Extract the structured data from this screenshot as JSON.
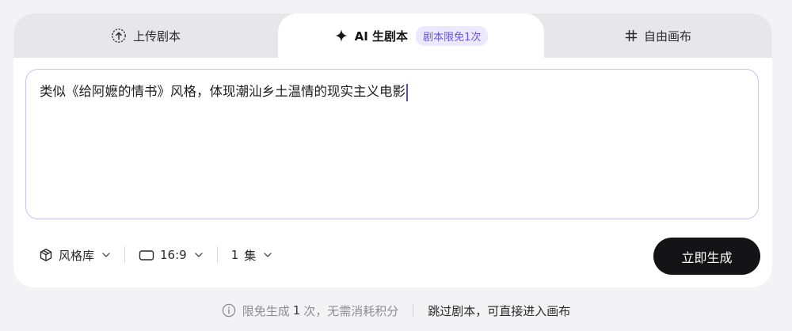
{
  "tabs": {
    "upload": {
      "label": "上传剧本",
      "icon": "upload-circle-icon"
    },
    "ai": {
      "label": "AI 生剧本",
      "icon": "sparkle-icon",
      "badge": "剧本限免1次"
    },
    "free": {
      "label": "自由画布",
      "icon": "hash-icon"
    }
  },
  "prompt": {
    "value": "类似《给阿嬷的情书》风格，体现潮汕乡土温情的现实主义电影"
  },
  "toolbar": {
    "style_library": {
      "label": "风格库",
      "icon": "cube-icon"
    },
    "aspect_ratio": {
      "label": "16:9",
      "icon": "rectangle-icon"
    },
    "episodes": {
      "value": "1",
      "unit": "集"
    }
  },
  "generate_button": {
    "label": "立即生成"
  },
  "footer": {
    "notice_prefix": "限免生成",
    "notice_count": "1",
    "notice_suffix": "次，无需消耗积分",
    "skip_link": "跳过剧本，可直接进入画布"
  },
  "colors": {
    "accent": "#6b52e6",
    "badge_bg": "#ece8ff",
    "button_bg": "#141416",
    "page_bg": "#f3f3f5"
  }
}
